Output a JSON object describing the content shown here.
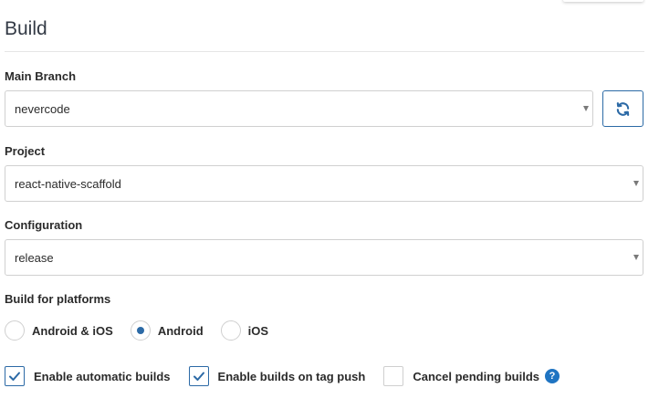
{
  "section": {
    "title": "Build"
  },
  "main_branch": {
    "label": "Main Branch",
    "value": "nevercode"
  },
  "project": {
    "label": "Project",
    "value": "react-native-scaffold"
  },
  "configuration": {
    "label": "Configuration",
    "value": "release"
  },
  "platforms": {
    "label": "Build for platforms",
    "options": [
      {
        "label": "Android & iOS",
        "checked": false
      },
      {
        "label": "Android",
        "checked": true
      },
      {
        "label": "iOS",
        "checked": false
      }
    ]
  },
  "options": [
    {
      "label": "Enable automatic builds",
      "checked": true
    },
    {
      "label": "Enable builds on tag push",
      "checked": true
    },
    {
      "label": "Cancel pending builds",
      "checked": false
    }
  ],
  "icons": {
    "refresh": "refresh-icon",
    "caret": "chevron-down-icon",
    "check": "check-icon",
    "help": "help-icon"
  },
  "help_glyph": "?",
  "colors": {
    "accent": "#2c6aa6",
    "help": "#1f74c2",
    "border": "#d0d0d0"
  }
}
